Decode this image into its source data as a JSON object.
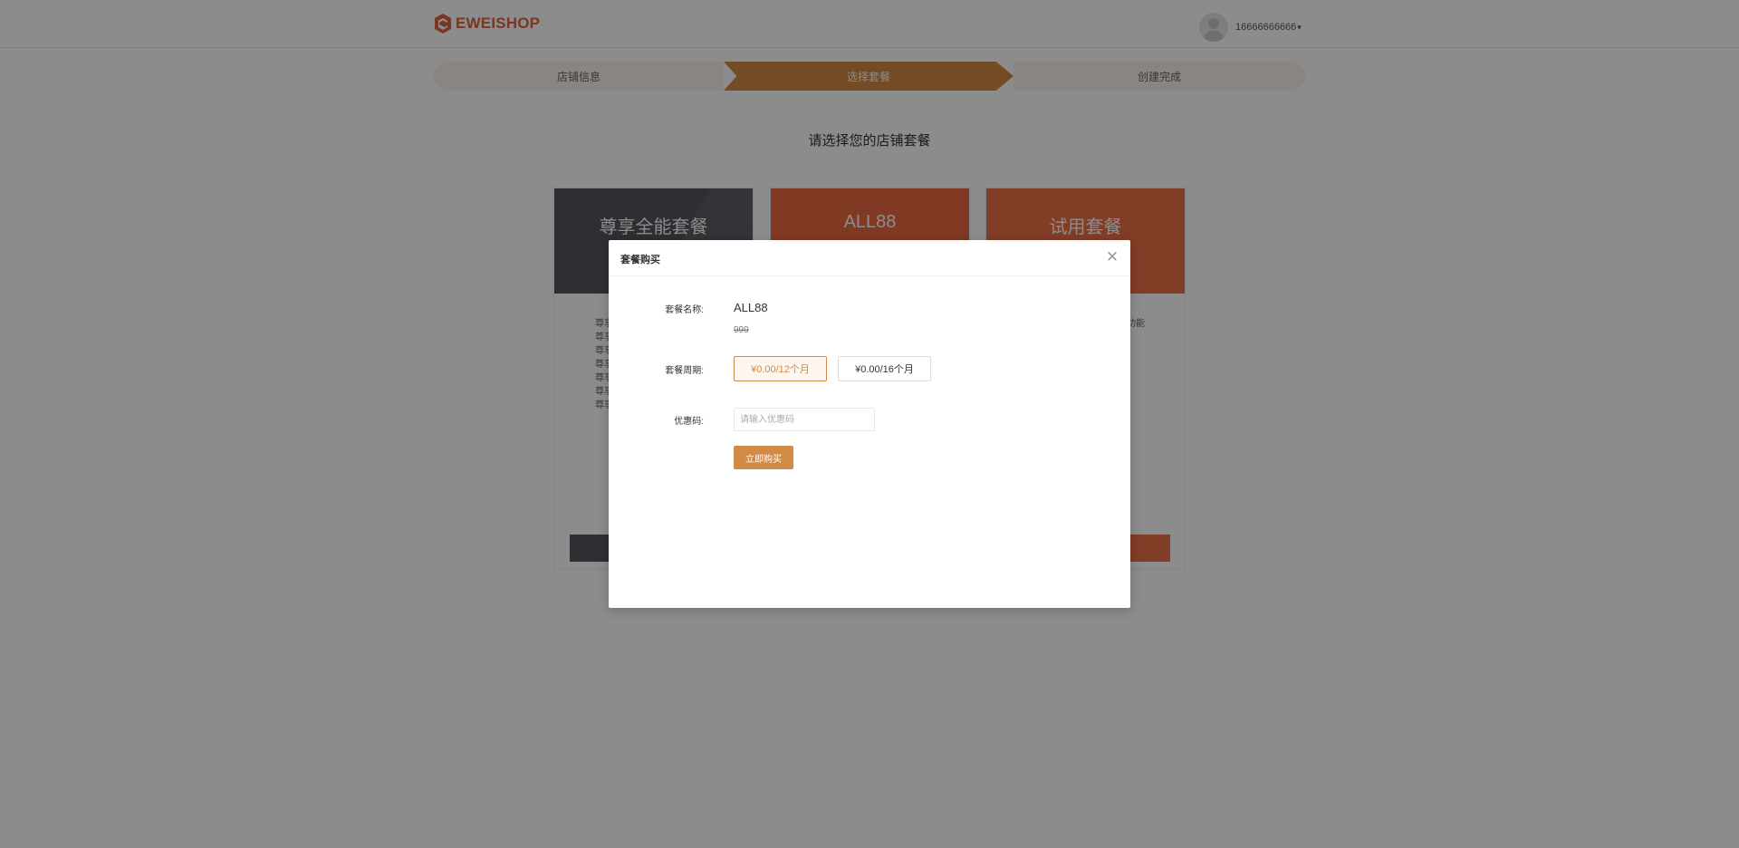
{
  "header": {
    "logo_text": "EWEISHOP",
    "brand_color": "#e0623b",
    "user_name": "16666666666",
    "caret": "▾"
  },
  "steps": [
    {
      "label": "店铺信息",
      "state": "done"
    },
    {
      "label": "选择套餐",
      "state": "active"
    },
    {
      "label": "创建完成",
      "state": "pending"
    }
  ],
  "page_title": "请选择您的店铺套餐",
  "packages": [
    {
      "name": "尊享全能套餐",
      "color": "#55555d",
      "features_visible": [
        "尊享",
        "尊享",
        "尊享",
        "尊享",
        "尊享",
        "尊享",
        "尊享"
      ]
    },
    {
      "name": "ALL88",
      "color": "#e9683f"
    },
    {
      "name": "试用套餐",
      "color": "#ed6f48",
      "feature_visible": "功能"
    }
  ],
  "modal": {
    "title": "套餐购买",
    "close_icon": "close-icon",
    "name_label": "套餐名称:",
    "name_value": "ALL88",
    "price": "999",
    "period_label": "套餐周期:",
    "periods": [
      {
        "label": "¥0.00/12个月",
        "selected": true
      },
      {
        "label": "¥0.00/16个月",
        "selected": false
      }
    ],
    "coupon_label": "优惠码:",
    "coupon_placeholder": "请输入优惠码",
    "coupon_value": "",
    "buy_label": "立即购买",
    "accent_color": "#d18b46"
  }
}
